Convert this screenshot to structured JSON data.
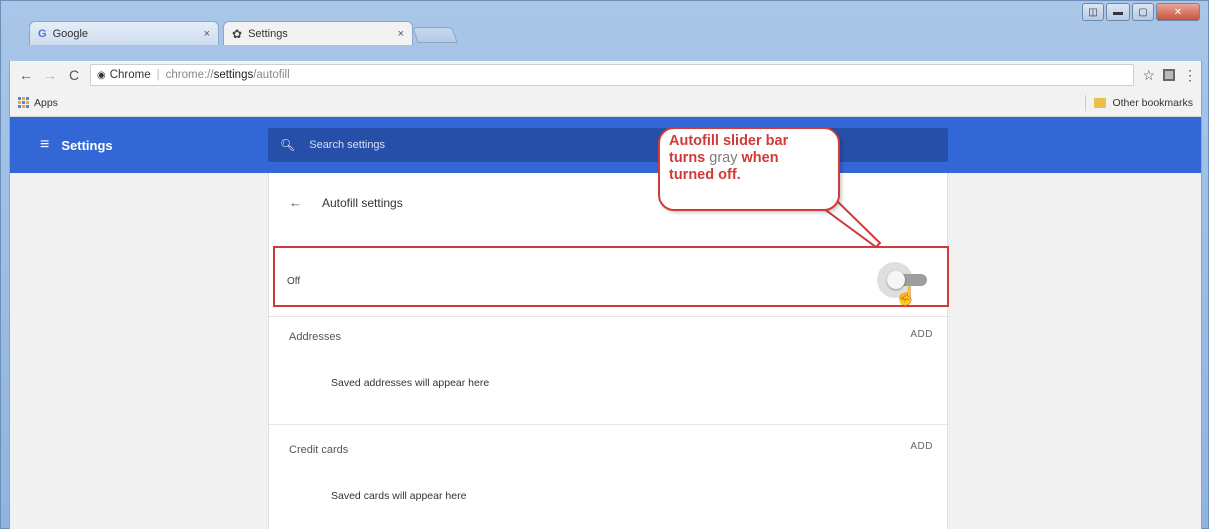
{
  "browser": {
    "tabs": [
      {
        "label": "Google",
        "close": "×"
      },
      {
        "label": "Settings",
        "close": "×"
      }
    ],
    "toolbar": {
      "back": "←",
      "forward": "→",
      "reload": "C",
      "site_chip": "Chrome",
      "separator": "|",
      "url_scheme": "chrome://",
      "url_host": "settings",
      "url_path": "/autofill",
      "star": "☆",
      "menu": "⋮"
    },
    "bookmarks": {
      "apps": "Apps",
      "other": "Other bookmarks"
    }
  },
  "settings": {
    "menu_icon": "≡",
    "title": "Settings",
    "search_placeholder": "Search settings",
    "page": {
      "back": "←",
      "heading": "Autofill settings",
      "toggle_label": "Off",
      "toggle_state": false,
      "sections": [
        {
          "label": "Addresses",
          "action": "ADD",
          "empty": "Saved addresses will appear here"
        },
        {
          "label": "Credit cards",
          "action": "ADD",
          "empty": "Saved cards will appear here"
        }
      ]
    }
  },
  "annotation": {
    "line1": "Autofill slider bar",
    "line2_a": "turns",
    "line2_b": "gray",
    "line2_c": "when",
    "line3": "turned off."
  },
  "colors": {
    "header_blue": "#3367d6",
    "annotation_red": "#d13a3a",
    "toggle_off_gray": "#9e9e9e"
  }
}
